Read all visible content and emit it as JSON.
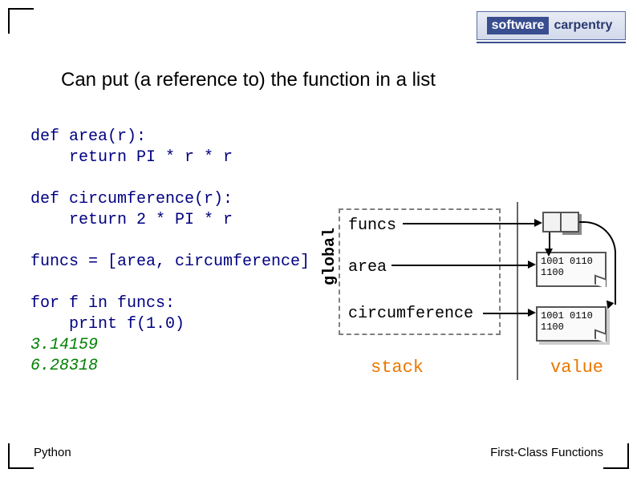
{
  "logo": {
    "software": "software",
    "carpentry": "carpentry"
  },
  "title": "Can put (a reference to) the function in a list",
  "code": {
    "l1": "def area(r):",
    "l2": "    return PI * r * r",
    "l3": "",
    "l4": "def circumference(r):",
    "l5": "    return 2 * PI * r",
    "l6": "",
    "l7": "funcs = [area, circumference]",
    "l8": "",
    "l9": "for f in funcs:",
    "l10": "    print f(1.0)",
    "out1": "3.14159",
    "out2": "6.28318"
  },
  "diagram": {
    "global": "global",
    "labels": {
      "funcs": "funcs",
      "area": "area",
      "circ": "circumference"
    },
    "stack": "stack",
    "value": "value",
    "machine_code1": "1001 0110\n1100",
    "machine_code2": "1001 0110\n1100"
  },
  "footer": {
    "left": "Python",
    "right": "First-Class Functions"
  }
}
